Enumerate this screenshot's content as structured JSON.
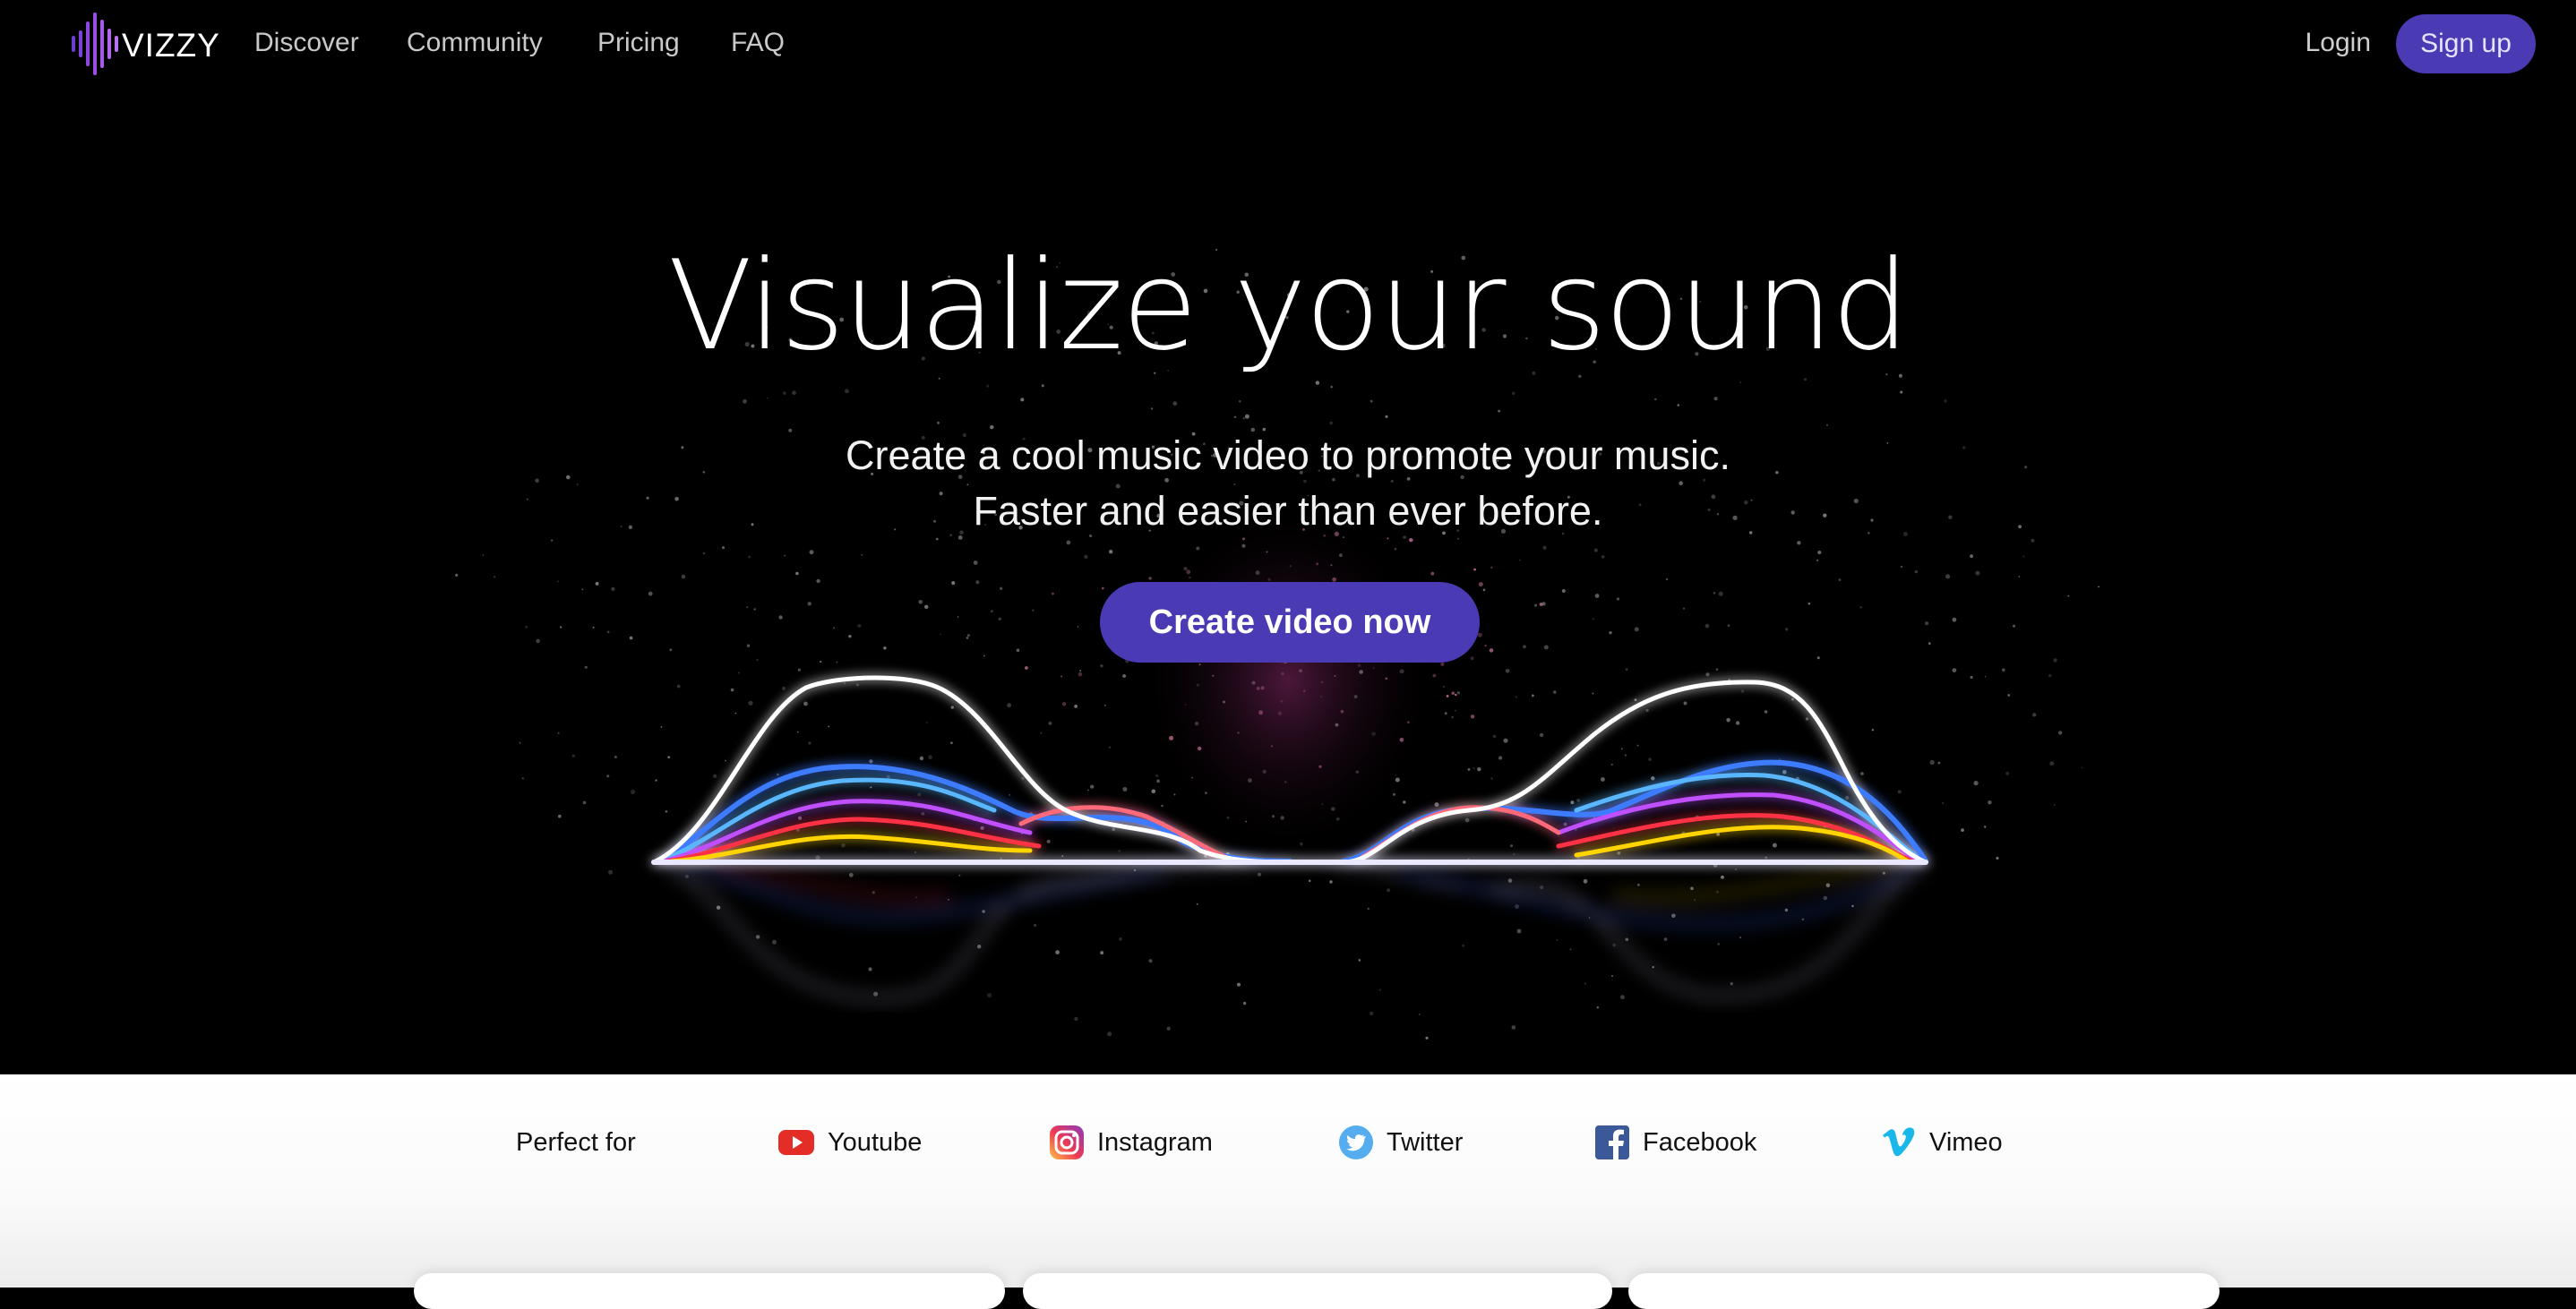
{
  "nav": {
    "logo_text": "VIZZY",
    "links": [
      "Discover",
      "Community",
      "Pricing",
      "FAQ"
    ],
    "login_label": "Login",
    "signup_label": "Sign up"
  },
  "hero": {
    "title": "Visualize your sound",
    "subtitle_line1": "Create a cool music video to promote your music.",
    "subtitle_line2": "Faster and easier than ever before.",
    "cta_label": "Create video now"
  },
  "platforms": {
    "label": "Perfect for",
    "items": [
      {
        "name": "Youtube",
        "icon": "youtube-icon"
      },
      {
        "name": "Instagram",
        "icon": "instagram-icon"
      },
      {
        "name": "Twitter",
        "icon": "twitter-icon"
      },
      {
        "name": "Facebook",
        "icon": "facebook-icon"
      },
      {
        "name": "Vimeo",
        "icon": "vimeo-icon"
      }
    ]
  },
  "colors": {
    "accent": "#4a3ab4",
    "background": "#000000",
    "youtube": "#e52d27",
    "twitter": "#55acee",
    "facebook": "#3b5998",
    "vimeo": "#1ab7ea"
  }
}
